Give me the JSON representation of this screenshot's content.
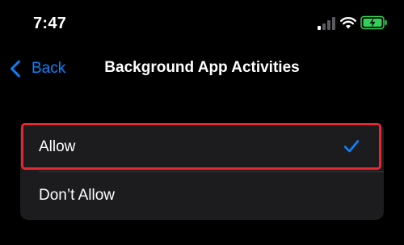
{
  "status_bar": {
    "time": "7:47",
    "signal_icon": "cellular-signal-icon",
    "wifi_icon": "wifi-icon",
    "battery_icon": "battery-charging-icon",
    "battery_color": "#30d158"
  },
  "nav": {
    "back_label": "Back",
    "back_icon": "chevron-left-icon",
    "title": "Background App Activities"
  },
  "options": [
    {
      "label": "Allow",
      "selected": true
    },
    {
      "label": "Don’t Allow",
      "selected": false
    }
  ],
  "selected_icon": "checkmark-icon",
  "colors": {
    "accent": "#0a84ff",
    "highlight": "#e8262d",
    "background": "#000000",
    "cell_background": "#1c1c1e"
  }
}
